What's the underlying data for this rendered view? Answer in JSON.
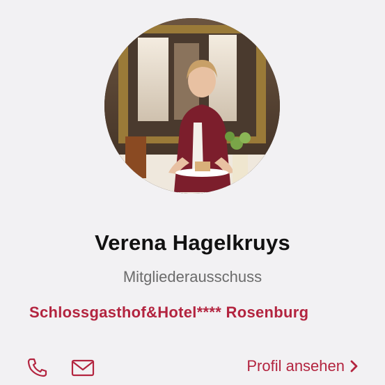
{
  "profile": {
    "name": "Verena Hagelkruys",
    "role": "Mitgliederausschuss",
    "company": "Schlossgasthof&Hotel**** Rosenburg"
  },
  "actions": {
    "phone_icon": "phone-icon",
    "mail_icon": "mail-icon",
    "profile_link_label": "Profil ansehen",
    "profile_link_icon": "chevron-right-icon"
  },
  "colors": {
    "accent": "#b3243f",
    "background": "#f2f1f3",
    "name_text": "#111111",
    "role_text": "#6b6b6b"
  }
}
